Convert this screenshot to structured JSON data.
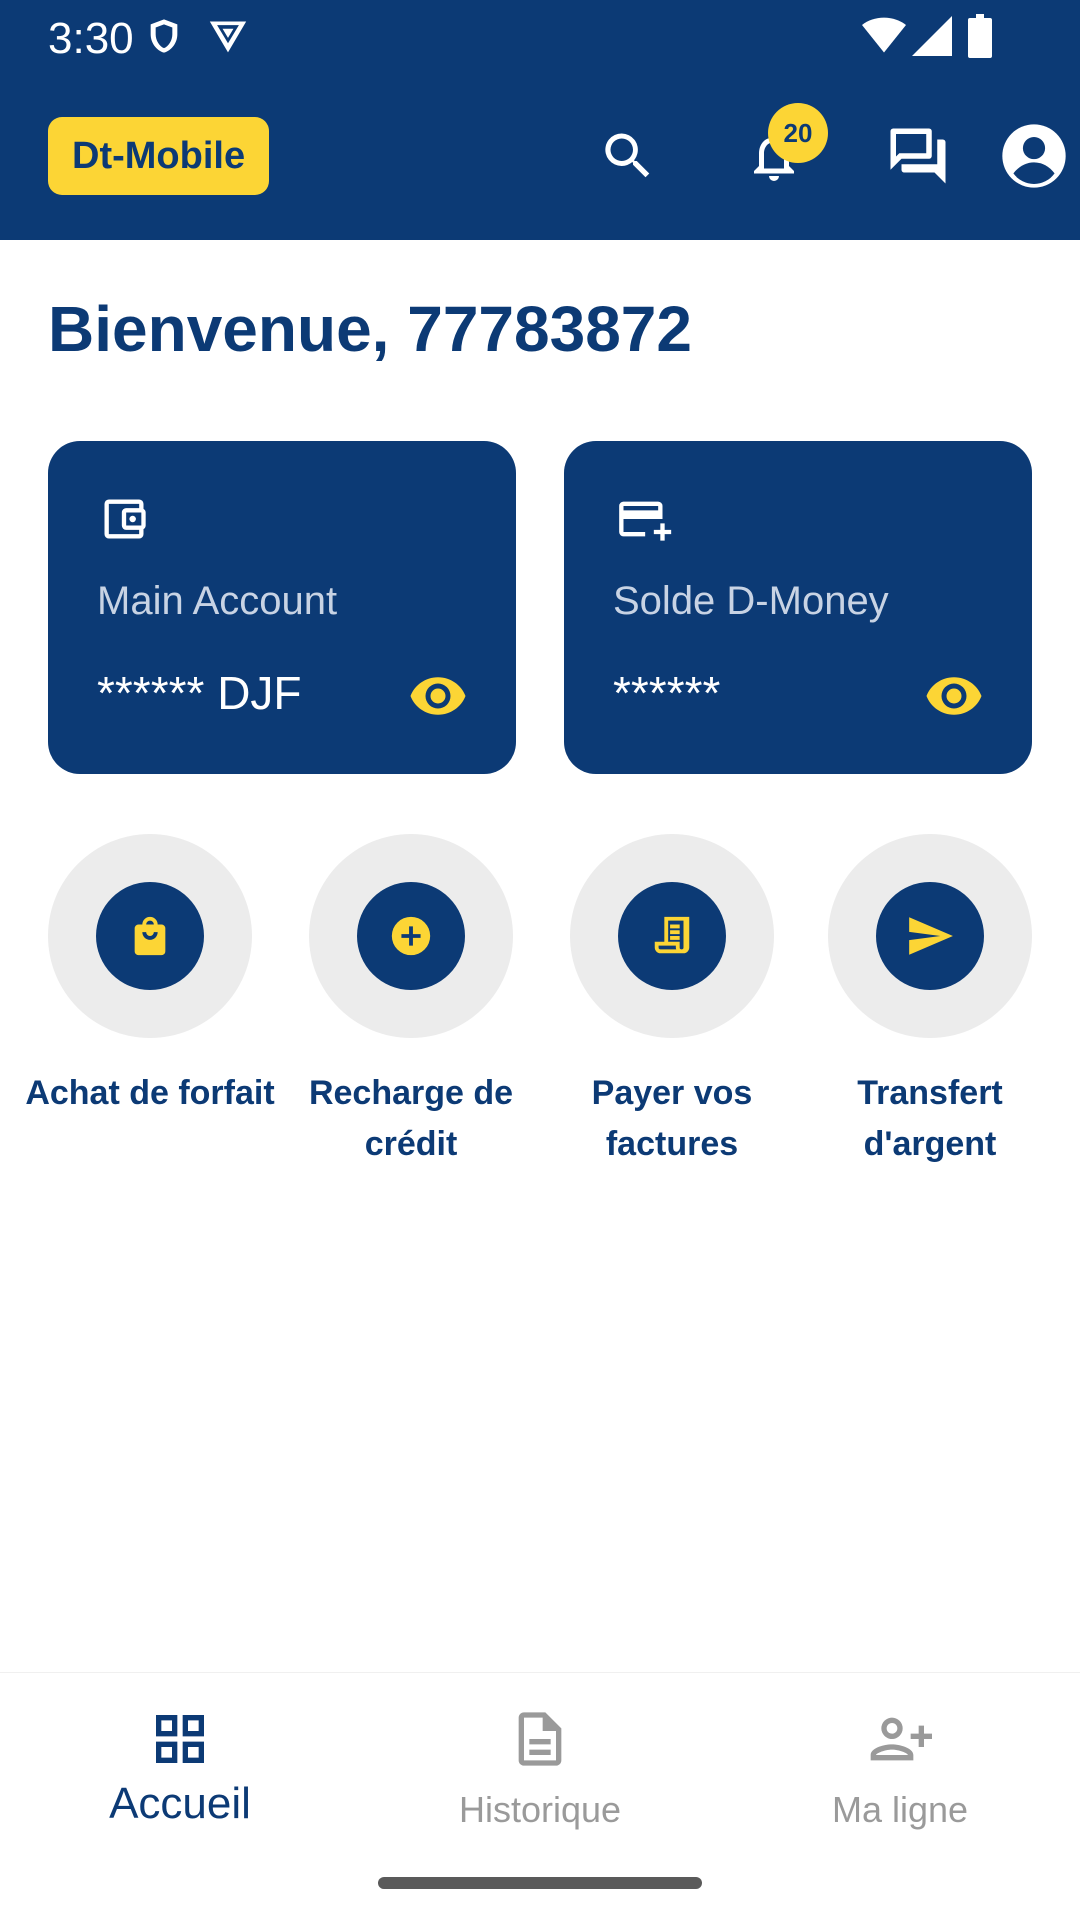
{
  "status_bar": {
    "time": "3:30"
  },
  "header": {
    "brand": "Dt-Mobile",
    "notification_count": "20",
    "icons": [
      "search-icon",
      "bell-icon",
      "chat-icon",
      "account-icon"
    ]
  },
  "welcome": "Bienvenue, 77783872",
  "cards": [
    {
      "label": "Main Account",
      "value": "****** DJF",
      "icon": "wallet-icon"
    },
    {
      "label": "Solde D-Money",
      "value": "******",
      "icon": "card-add-icon"
    }
  ],
  "actions": [
    {
      "label": "Achat de forfait",
      "icon": "shopping-bag-icon"
    },
    {
      "label": "Recharge de crédit",
      "icon": "plus-circle-icon"
    },
    {
      "label": "Payer vos factures",
      "icon": "receipt-icon"
    },
    {
      "label": "Transfert d'argent",
      "icon": "send-icon"
    }
  ],
  "bottom_nav": [
    {
      "label": "Accueil",
      "active": true,
      "icon": "grid-icon"
    },
    {
      "label": "Historique",
      "active": false,
      "icon": "document-icon"
    },
    {
      "label": "Ma ligne",
      "active": false,
      "icon": "person-add-icon"
    }
  ],
  "colors": {
    "primary": "#0c3a75",
    "accent": "#fcd535",
    "action_bg": "#ececec",
    "inactive": "#9a9a9a"
  }
}
